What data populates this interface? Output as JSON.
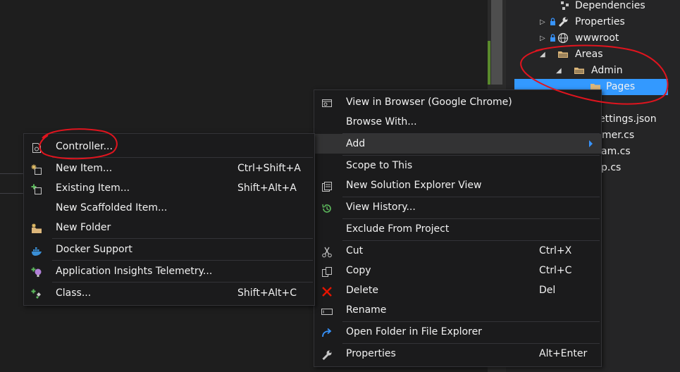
{
  "solution_explorer": {
    "items": [
      {
        "label": "Dependencies",
        "icon": "dependencies-icon"
      },
      {
        "label": "Properties",
        "icon": "wrench-icon"
      },
      {
        "label": "wwwroot",
        "icon": "globe-icon"
      },
      {
        "label": "Areas",
        "icon": "folder-icon"
      },
      {
        "label": "Admin",
        "icon": "folder-icon"
      },
      {
        "label": "Pages",
        "icon": "folder-icon"
      },
      {
        "label": "ettings.json"
      },
      {
        "label": "mer.cs"
      },
      {
        "label": "am.cs"
      },
      {
        "label": "p.cs"
      }
    ],
    "selected": "Pages"
  },
  "context_menu": {
    "items": [
      {
        "label": "View in Browser (Google Chrome)",
        "icon": "browser-icon"
      },
      {
        "label": "Browse With..."
      },
      {
        "label": "Add",
        "submenu": true
      },
      {
        "label": "Scope to This"
      },
      {
        "label": "New Solution Explorer View",
        "icon": "new-view-icon"
      },
      {
        "label": "View History...",
        "icon": "history-icon"
      },
      {
        "label": "Exclude From Project"
      },
      {
        "label": "Cut",
        "shortcut": "Ctrl+X",
        "icon": "scissors-icon"
      },
      {
        "label": "Copy",
        "shortcut": "Ctrl+C",
        "icon": "copy-icon"
      },
      {
        "label": "Delete",
        "shortcut": "Del",
        "icon": "delete-icon"
      },
      {
        "label": "Rename",
        "icon": "rename-icon"
      },
      {
        "label": "Open Folder in File Explorer",
        "icon": "refresh-arrow-icon"
      },
      {
        "label": "Properties",
        "shortcut": "Alt+Enter",
        "icon": "wrench-icon"
      }
    ]
  },
  "add_submenu": {
    "items": [
      {
        "label": "Controller...",
        "icon": "controller-icon"
      },
      {
        "label": "New Item...",
        "shortcut": "Ctrl+Shift+A",
        "icon": "new-item-icon"
      },
      {
        "label": "Existing Item...",
        "shortcut": "Shift+Alt+A",
        "icon": "existing-item-icon"
      },
      {
        "label": "New Scaffolded Item..."
      },
      {
        "label": "New Folder",
        "icon": "new-folder-icon"
      },
      {
        "label": "Docker Support",
        "icon": "docker-icon"
      },
      {
        "label": "Application Insights Telemetry...",
        "icon": "insights-icon"
      },
      {
        "label": "Class...",
        "shortcut": "Shift+Alt+C",
        "icon": "class-icon"
      }
    ]
  },
  "annotation_color": "#e0141e",
  "accent_color": "#3399ff"
}
